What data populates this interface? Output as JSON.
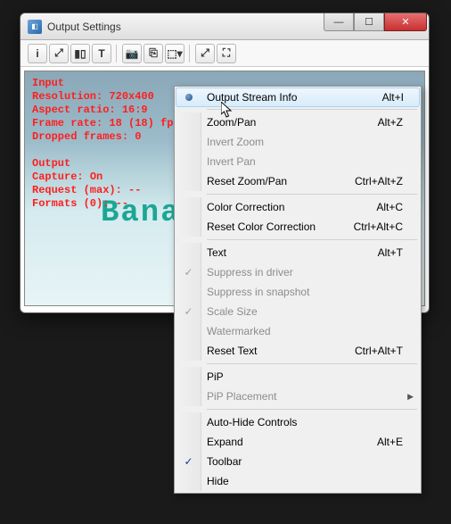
{
  "window": {
    "title": "Output Settings"
  },
  "osd": {
    "input_header": "Input",
    "resolution_label": "Resolution:",
    "resolution_value": "720x400",
    "aspect_label": "Aspect ratio:",
    "aspect_value": "16:9",
    "framerate_label": "Frame rate:",
    "framerate_value": "18 (18) fps",
    "dropped_label": "Dropped frames:",
    "dropped_value": "0",
    "output_header": "Output",
    "capture_label": "Capture:",
    "capture_value": "On",
    "request_label": "Request (max):",
    "request_value": "--",
    "formats_label": "Formats (0):",
    "formats_value": "--"
  },
  "video_text": "Bana",
  "menu": [
    {
      "type": "item",
      "label": "Output Stream Info",
      "accel": "Alt+I",
      "icon": "bullet",
      "highlighted": true
    },
    {
      "type": "sep"
    },
    {
      "type": "item",
      "label": "Zoom/Pan",
      "accel": "Alt+Z"
    },
    {
      "type": "item",
      "label": "Invert Zoom",
      "disabled": true
    },
    {
      "type": "item",
      "label": "Invert Pan",
      "disabled": true
    },
    {
      "type": "item",
      "label": "Reset Zoom/Pan",
      "accel": "Ctrl+Alt+Z"
    },
    {
      "type": "sep"
    },
    {
      "type": "item",
      "label": "Color Correction",
      "accel": "Alt+C"
    },
    {
      "type": "item",
      "label": "Reset Color Correction",
      "accel": "Ctrl+Alt+C"
    },
    {
      "type": "sep"
    },
    {
      "type": "item",
      "label": "Text",
      "accel": "Alt+T"
    },
    {
      "type": "item",
      "label": "Suppress in driver",
      "disabled": true,
      "checked": true
    },
    {
      "type": "item",
      "label": "Suppress in snapshot",
      "disabled": true
    },
    {
      "type": "item",
      "label": "Scale Size",
      "disabled": true,
      "checked": true
    },
    {
      "type": "item",
      "label": "Watermarked",
      "disabled": true
    },
    {
      "type": "item",
      "label": "Reset Text",
      "accel": "Ctrl+Alt+T"
    },
    {
      "type": "sep"
    },
    {
      "type": "item",
      "label": "PiP"
    },
    {
      "type": "item",
      "label": "PiP Placement",
      "disabled": true,
      "submenu": true
    },
    {
      "type": "sep"
    },
    {
      "type": "item",
      "label": "Auto-Hide Controls"
    },
    {
      "type": "item",
      "label": "Expand",
      "accel": "Alt+E"
    },
    {
      "type": "item",
      "label": "Toolbar",
      "checked": true
    },
    {
      "type": "item",
      "label": "Hide"
    }
  ],
  "toolbar_icons": [
    "i",
    "⤢",
    "▮▯",
    "T",
    "📷",
    "⎘",
    "⬚▾",
    "⤢",
    "⛶"
  ]
}
